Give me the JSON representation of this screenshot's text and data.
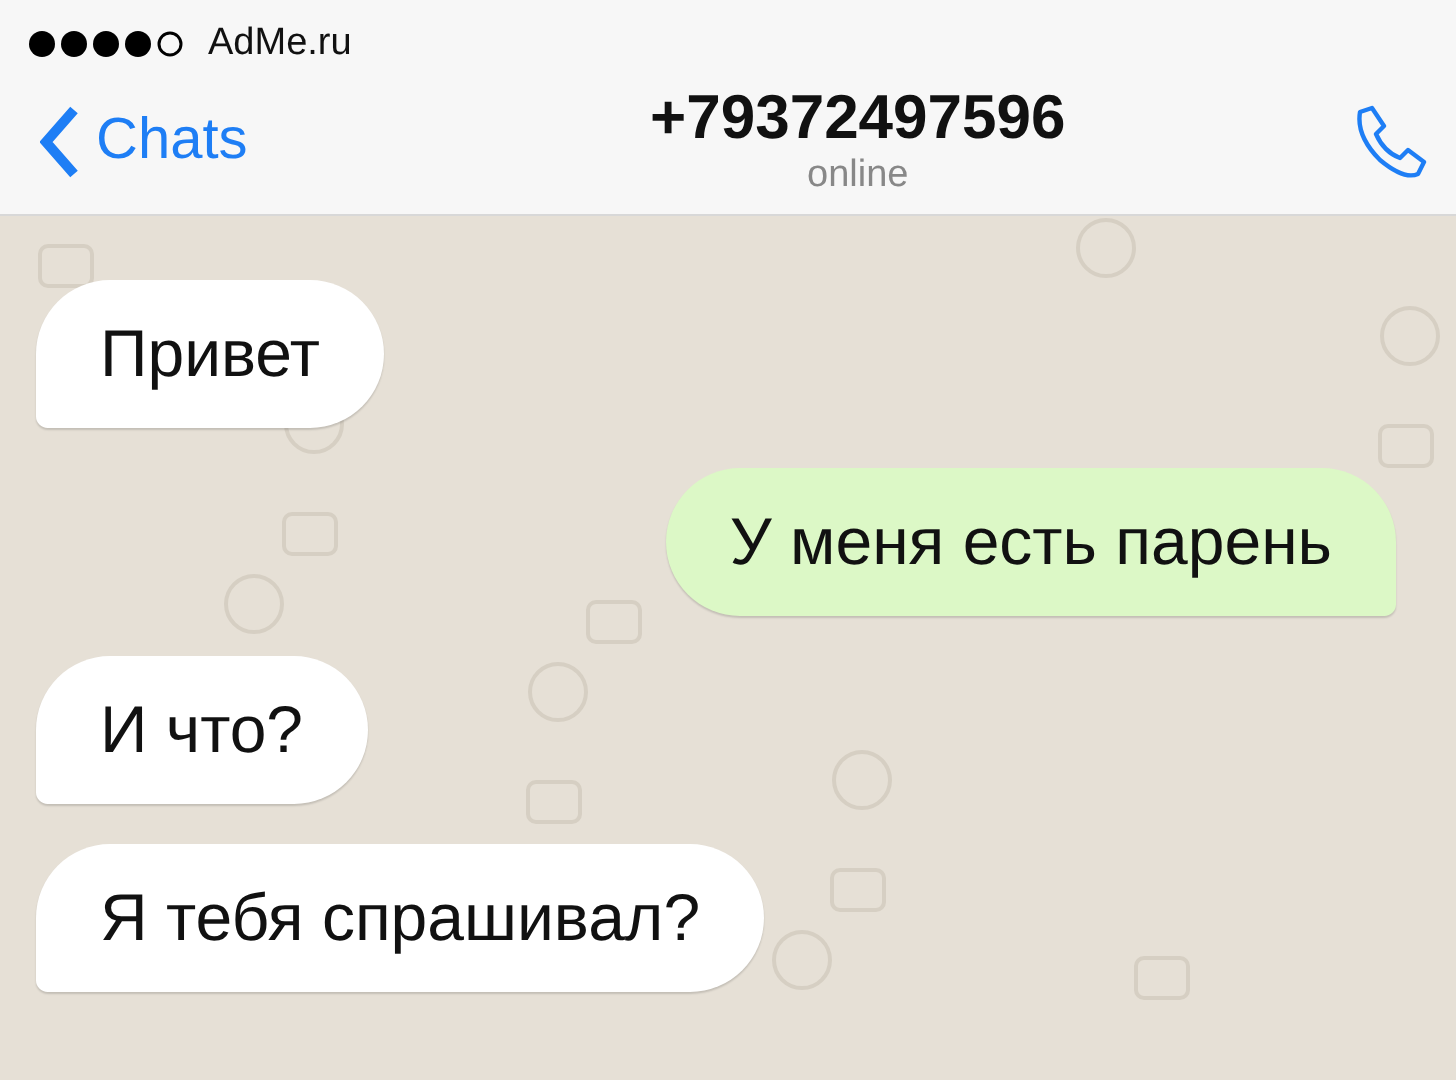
{
  "status_bar": {
    "carrier": "AdMe.ru"
  },
  "header": {
    "back_label": "Chats",
    "title": "+79372497596",
    "subtitle": "online"
  },
  "messages": [
    {
      "kind": "incoming",
      "text": "Привет"
    },
    {
      "kind": "outgoing",
      "text": "У меня есть парень"
    },
    {
      "kind": "incoming",
      "text": "И что?"
    },
    {
      "kind": "incoming",
      "text": "Я тебя спрашивал?"
    }
  ]
}
